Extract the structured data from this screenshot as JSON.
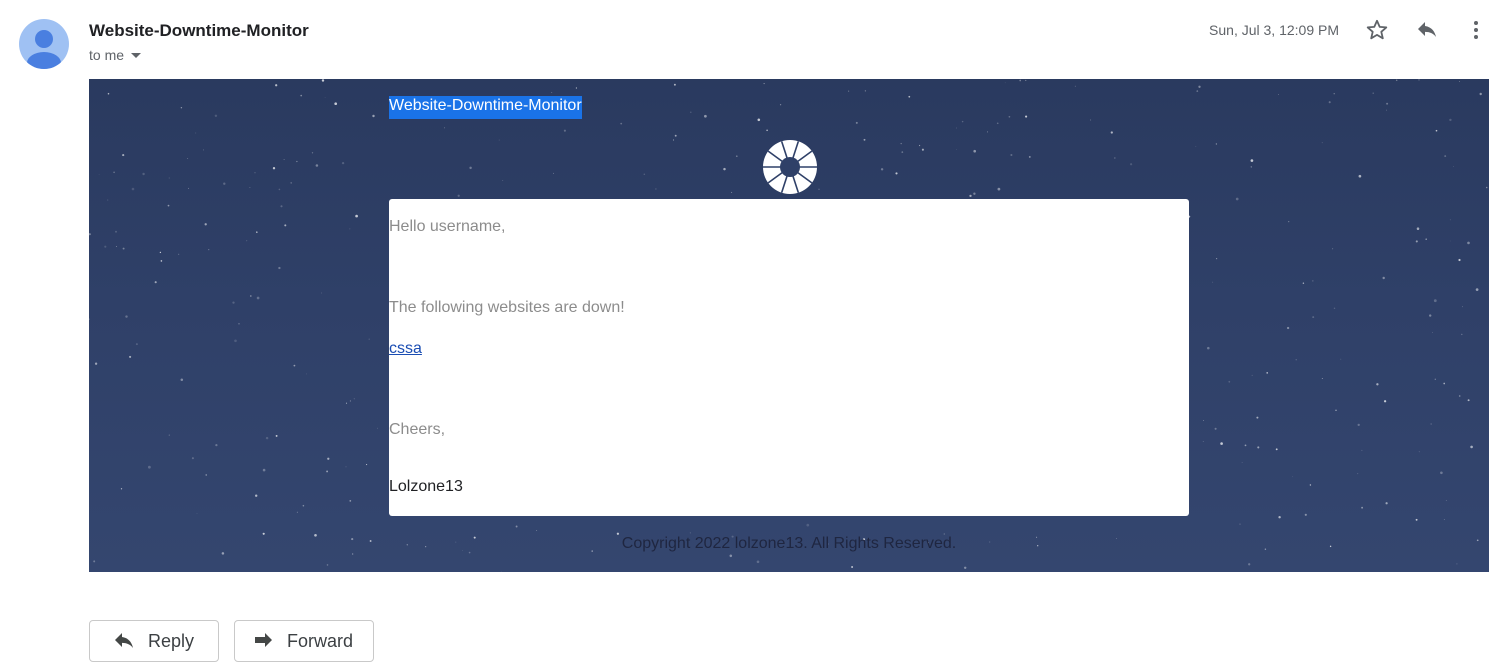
{
  "header": {
    "sender": "Website-Downtime-Monitor",
    "recipient": "to me",
    "date": "Sun, Jul 3, 12:09 PM",
    "icons": {
      "avatar": "person-avatar-icon",
      "star": "star-icon",
      "reply": "reply-icon",
      "more": "more-vertical-icon",
      "caret": "caret-down-icon"
    }
  },
  "message": {
    "title": "Website-Downtime-Monitor",
    "logo": "wheel-logo-icon",
    "greeting": "Hello username,",
    "down_message": "The following websites are down!",
    "site_link": "cssa",
    "closing": "Cheers,",
    "signature": "Lolzone13",
    "copyright": "Copyright 2022 lolzone13. All Rights Reserved."
  },
  "actions": {
    "reply_label": "Reply",
    "forward_label": "Forward"
  },
  "colors": {
    "banner": "#2f4068",
    "title_highlight": "#1a73e8",
    "link": "#1a4db3",
    "avatar_bg": "#9fc1f3",
    "avatar_fg": "#4a7fe0"
  }
}
